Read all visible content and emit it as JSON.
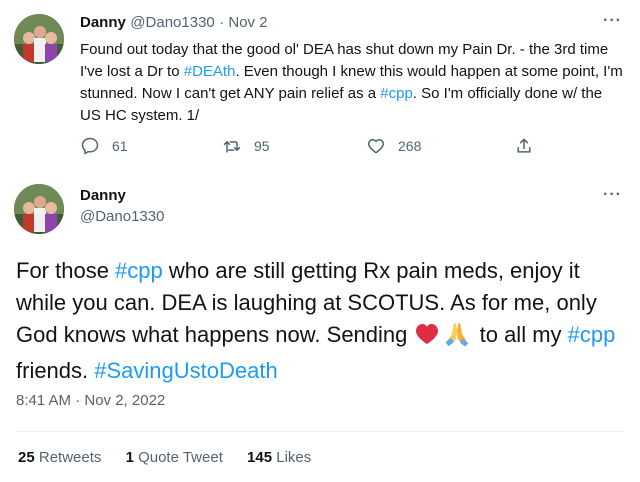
{
  "tweet1": {
    "name": "Danny",
    "handle": "@Dano1330",
    "date": "· Nov 2",
    "text_parts": [
      "Found out today that the good ol' DEA has shut down my Pain Dr. - the 3rd time I've lost a Dr to ",
      "#DEAth",
      ". Even though I knew this would happen at some point, I'm stunned. Now I can't get ANY pain relief as a ",
      "#cpp",
      ". So I'm officially done w/ the US HC system. 1/"
    ],
    "replies": "61",
    "retweets": "95",
    "likes": "268",
    "more": "···"
  },
  "tweet2": {
    "name": "Danny",
    "handle": "@Dano1330",
    "more": "···",
    "text_parts": [
      "For those ",
      "#cpp",
      " who are still getting Rx pain meds, enjoy it while you can. DEA is laughing at SCOTUS. As for me, only God knows what happens now. Sending ",
      " to all my ",
      "#cpp",
      " friends. ",
      "#SavingUstoDeath"
    ],
    "timestamp": "8:41 AM · Nov 2, 2022",
    "stats": {
      "retweets_count": "25",
      "retweets_label": "Retweets",
      "quotes_count": "1",
      "quotes_label": "Quote Tweet",
      "likes_count": "145",
      "likes_label": "Likes"
    }
  },
  "colors": {
    "link": "#1d9bf0",
    "muted": "#536471",
    "text": "#0f1419"
  }
}
